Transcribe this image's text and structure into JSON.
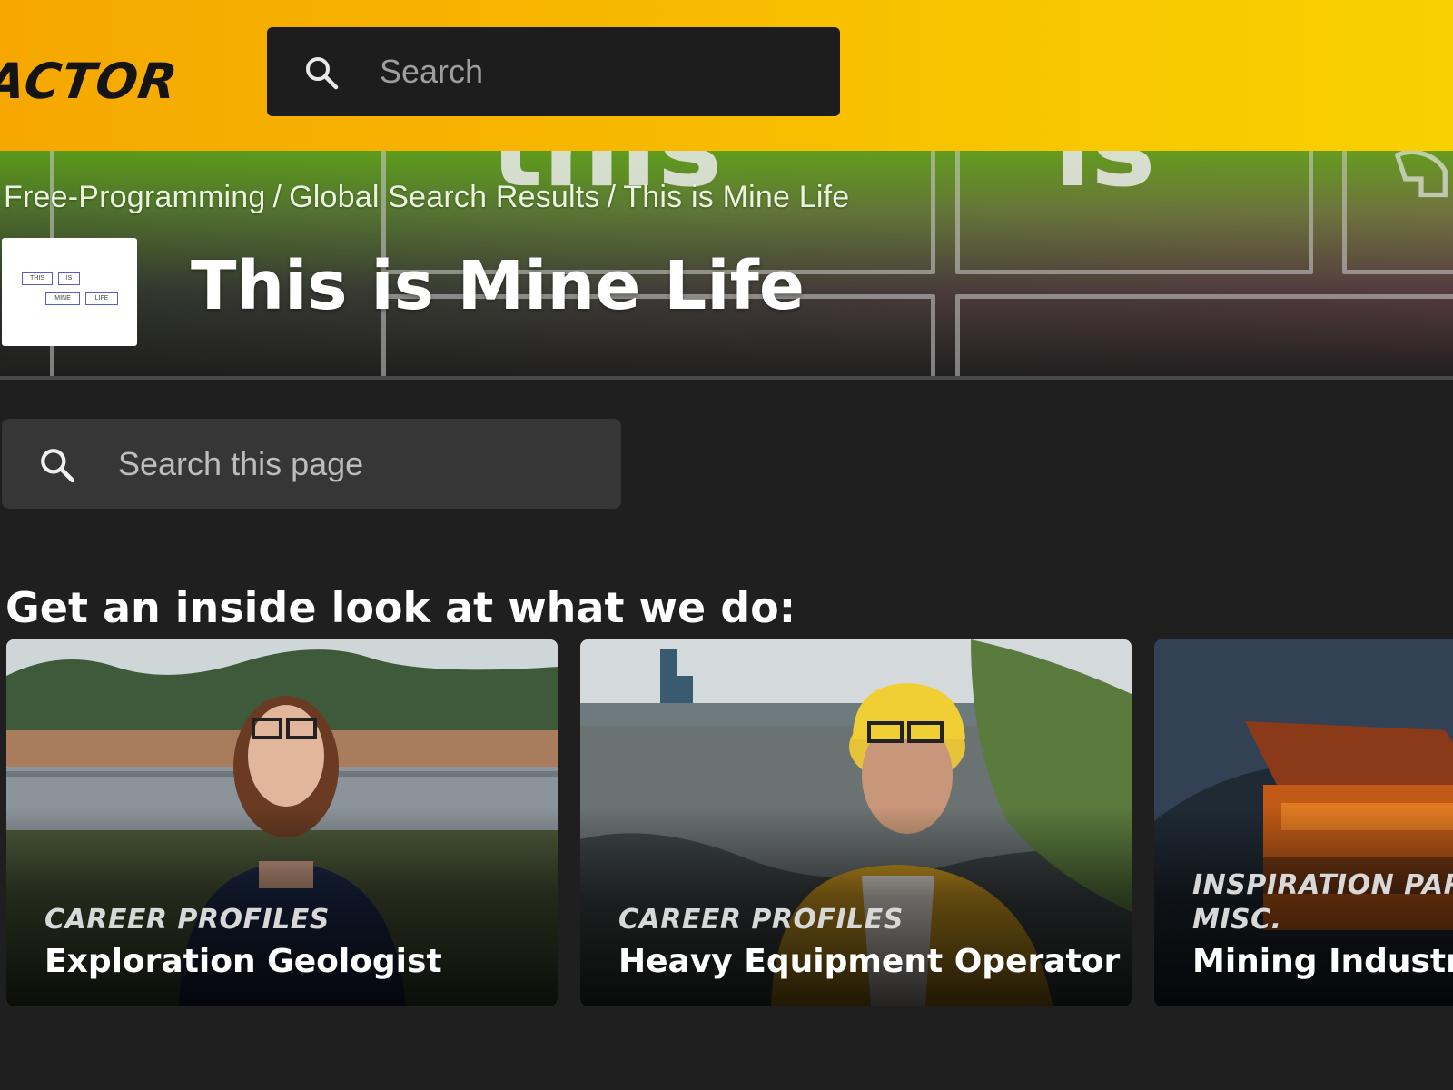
{
  "header": {
    "logo_text": "ACTOR",
    "search": {
      "placeholder": "Search",
      "value": ""
    }
  },
  "hero": {
    "background_text": [
      "this",
      "is"
    ],
    "breadcrumb": [
      "Free-Programming",
      "Global Search Results",
      "This is Mine Life"
    ],
    "separator": "/",
    "logo_boxes": [
      "THIS",
      "IS",
      "MINE",
      "LIFE"
    ],
    "title": "This is Mine Life"
  },
  "page_search": {
    "placeholder": "Search this page",
    "value": ""
  },
  "section": {
    "heading": "Get an inside look at what we do:",
    "cards": [
      {
        "tags": [
          "CAREER PROFILES"
        ],
        "title": "Exploration Geologist"
      },
      {
        "tags": [
          "CAREER PROFILES"
        ],
        "title": "Heavy Equipment Operator"
      },
      {
        "tags": [
          "INSPIRATION PART",
          "MISC."
        ],
        "title": "Mining Industry"
      }
    ]
  },
  "colors": {
    "brand_yellow": "#f7b400",
    "background": "#1f1f1f",
    "search_bg": "#1d1d1d",
    "page_search_bg": "#363636"
  },
  "icons": [
    "search-icon"
  ]
}
